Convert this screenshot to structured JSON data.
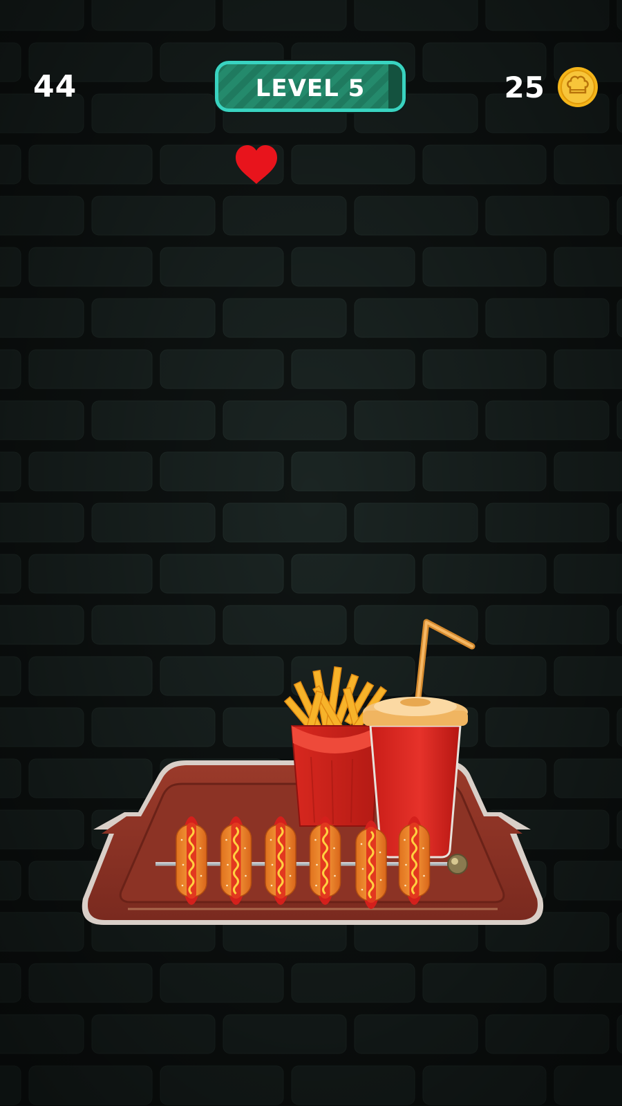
{
  "hud": {
    "score": "44",
    "level_label": "LEVEL 5",
    "coins": "25"
  },
  "icons": {
    "coin": "chef-hat-coin-icon",
    "life": "heart-icon"
  },
  "scene": {
    "items": [
      "tray",
      "french-fries",
      "soda-cup",
      "hot-dog-skewer"
    ],
    "hot_dog_count": 6
  },
  "colors": {
    "badge_border": "#39d3c0",
    "badge_fill": "#1f7a5f",
    "heart": "#e8141c",
    "coin": "#f4b51a",
    "wall": "#1a2422"
  }
}
